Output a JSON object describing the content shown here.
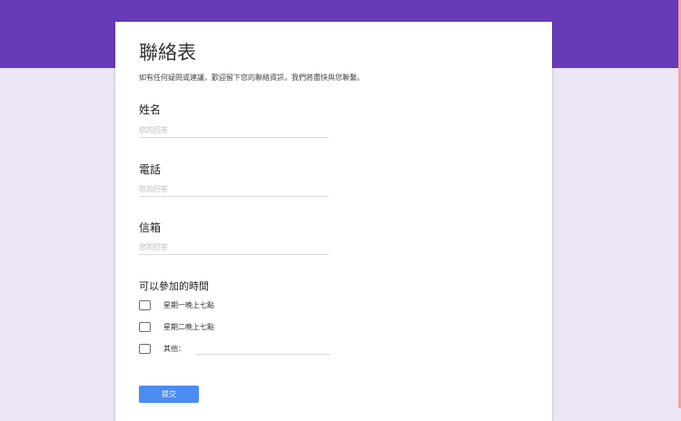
{
  "form": {
    "title": "聯絡表",
    "description": "如有任何疑問或建議，歡迎留下您的聯絡資訊，我們將盡快與您聯繫。"
  },
  "questions": [
    {
      "label": "姓名",
      "placeholder": "您的回答"
    },
    {
      "label": "電話",
      "placeholder": "您的回答"
    },
    {
      "label": "信箱",
      "placeholder": "您的回答"
    }
  ],
  "checkbox_question": {
    "label": "可以參加的時間",
    "options": [
      "星期一晚上七點",
      "星期二晚上七點",
      "其他："
    ]
  },
  "submit_label": "提交",
  "colors": {
    "banner": "#673ab7",
    "background": "#ece6f6",
    "button": "#4a8cf0"
  }
}
